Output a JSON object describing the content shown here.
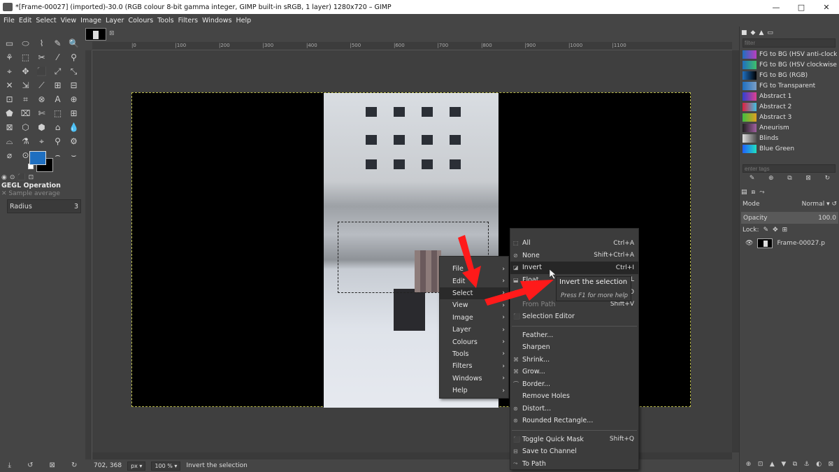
{
  "window": {
    "title": "*[Frame-00027] (imported)-30.0 (RGB colour 8-bit gamma integer, GIMP built-in sRGB, 1 layer) 1280x720 – GIMP",
    "minimize_icon": "—",
    "maximize_icon": "□",
    "close_icon": "✕"
  },
  "menubar": [
    "File",
    "Edit",
    "Select",
    "View",
    "Image",
    "Layer",
    "Colours",
    "Tools",
    "Filters",
    "Windows",
    "Help"
  ],
  "toolbox": {
    "tools": [
      "▭",
      "⬭",
      "⌇",
      "✎",
      "🔍",
      "⚘",
      "⬚",
      "✂",
      "⁄",
      "⚲",
      "⌖",
      "✥",
      "⬛",
      "⤢",
      "⤡",
      "✕",
      "⇲",
      "⟋",
      "⊞",
      "⊟",
      "⊡",
      "⌗",
      "⊗",
      "A",
      "⊕",
      "⬟",
      "⌧",
      "✄",
      "⬚",
      "⊞",
      "⊠",
      "⬡",
      "⬢",
      "⌂",
      "💧",
      "⌓",
      "⚗",
      "⌖",
      "⚲",
      "⚙",
      "⌀",
      "⊙",
      "⬥",
      "⌢",
      "⌣"
    ],
    "gegl_title": "GEGL Operation",
    "sample_label": "Sample average",
    "radius_label": "Radius",
    "radius_value": "3",
    "fg_color": "#1f6fc0",
    "bg_color": "#000000"
  },
  "ruler_ticks": [
    "|0",
    "|100",
    "|200",
    "|300",
    "|400",
    "|500",
    "|600",
    "|700",
    "|800",
    "|900",
    "|1000",
    "|1100"
  ],
  "statusbar": {
    "coords": "702, 368",
    "unit": "px",
    "zoom": "100 %",
    "message": "Invert the selection"
  },
  "context_menu": {
    "items": [
      {
        "label": "File",
        "arrow": "›"
      },
      {
        "label": "Edit",
        "arrow": "›"
      },
      {
        "label": "Select",
        "arrow": "›"
      },
      {
        "label": "View",
        "arrow": "›"
      },
      {
        "label": "Image",
        "arrow": "›"
      },
      {
        "label": "Layer",
        "arrow": "›"
      },
      {
        "label": "Colours",
        "arrow": "›"
      },
      {
        "label": "Tools",
        "arrow": "›"
      },
      {
        "label": "Filters",
        "arrow": "›"
      },
      {
        "label": "Windows",
        "arrow": "›"
      },
      {
        "label": "Help",
        "arrow": "›"
      }
    ]
  },
  "select_menu": {
    "group1": [
      {
        "label": "All",
        "shortcut": "Ctrl+A",
        "icon": "⬚"
      },
      {
        "label": "None",
        "shortcut": "Shift+Ctrl+A",
        "icon": "⊘"
      },
      {
        "label": "Invert",
        "shortcut": "Ctrl+I",
        "icon": "◪"
      },
      {
        "label": "Float",
        "shortcut": "L",
        "icon": "⬓"
      },
      {
        "label": "By",
        "shortcut": "O",
        "icon": "⬗"
      },
      {
        "label": "From Path",
        "shortcut": "Shift+V",
        "icon": ""
      },
      {
        "label": "Selection Editor",
        "shortcut": "",
        "icon": "⬛"
      }
    ],
    "group2": [
      {
        "label": "Feather...",
        "shortcut": "",
        "icon": ""
      },
      {
        "label": "Sharpen",
        "shortcut": "",
        "icon": ""
      },
      {
        "label": "Shrink...",
        "shortcut": "",
        "icon": "⌘"
      },
      {
        "label": "Grow...",
        "shortcut": "",
        "icon": "⌘"
      },
      {
        "label": "Border...",
        "shortcut": "",
        "icon": "⌒"
      },
      {
        "label": "Remove Holes",
        "shortcut": "",
        "icon": ""
      },
      {
        "label": "Distort...",
        "shortcut": "",
        "icon": "⊛"
      },
      {
        "label": "Rounded Rectangle...",
        "shortcut": "",
        "icon": "⊛"
      }
    ],
    "group3": [
      {
        "label": "Toggle Quick Mask",
        "shortcut": "Shift+Q",
        "icon": "⬛"
      },
      {
        "label": "Save to Channel",
        "shortcut": "",
        "icon": "⊟"
      },
      {
        "label": "To Path",
        "shortcut": "",
        "icon": "⤳"
      }
    ]
  },
  "tooltip": {
    "title": "Invert the selection",
    "hint": "Press F1 for more help"
  },
  "right_dock": {
    "filter_placeholder": "filter",
    "gradients": [
      {
        "name": "FG to BG (HSV anti-clockwise)",
        "colors": [
          "#1f6fc0",
          "#b93ec0"
        ]
      },
      {
        "name": "FG to BG (HSV clockwise)",
        "colors": [
          "#1f6fc0",
          "#3ec06a"
        ]
      },
      {
        "name": "FG to BG (RGB)",
        "colors": [
          "#1f6fc0",
          "#000000"
        ]
      },
      {
        "name": "FG to Transparent",
        "colors": [
          "#1f6fc0",
          "#7a9ec6"
        ]
      },
      {
        "name": "Abstract 1",
        "colors": [
          "#3040d0",
          "#e04090"
        ]
      },
      {
        "name": "Abstract 2",
        "colors": [
          "#e02040",
          "#40c0e0"
        ]
      },
      {
        "name": "Abstract 3",
        "colors": [
          "#40c040",
          "#e0a020"
        ]
      },
      {
        "name": "Aneurism",
        "colors": [
          "#202020",
          "#a060a0"
        ]
      },
      {
        "name": "Blinds",
        "colors": [
          "#e0e0e0",
          "#505050"
        ]
      },
      {
        "name": "Blue Green",
        "colors": [
          "#2060ff",
          "#20e0c0"
        ]
      }
    ],
    "tags_placeholder": "enter tags",
    "mode_label": "Mode",
    "mode_value": "Normal",
    "opacity_label": "Opacity",
    "opacity_value": "100.0",
    "lock_label": "Lock:",
    "layer_name": "Frame-00027.p"
  }
}
